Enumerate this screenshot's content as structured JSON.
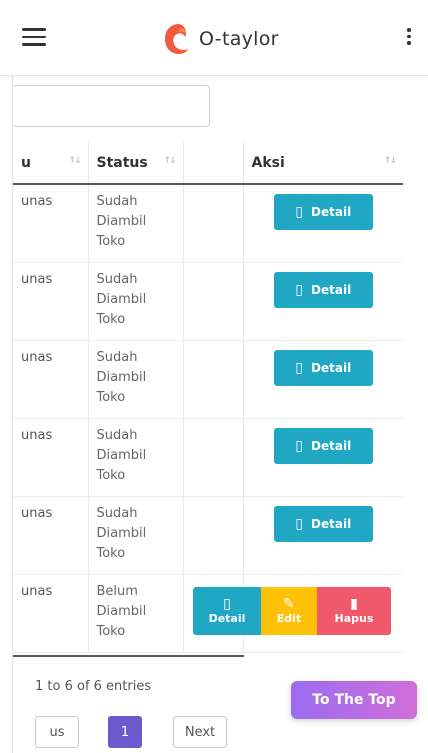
{
  "header": {
    "brand": "O-taylor"
  },
  "table": {
    "columns": [
      "",
      "Status",
      "",
      "Aksi"
    ],
    "sort_icon": "↑↓",
    "rows": [
      {
        "first": "unas",
        "status": "Sudah Diambil Toko",
        "action": "Detail"
      },
      {
        "first": "unas",
        "status": "Sudah Diambil Toko",
        "action": "Detail"
      },
      {
        "first": "unas",
        "status": "Sudah Diambil Toko",
        "action": "Detail"
      },
      {
        "first": "unas",
        "status": "Sudah Diambil Toko",
        "action": "Detail"
      },
      {
        "first": "unas",
        "status": "Sudah Diambil Toko",
        "action": "Detail"
      },
      {
        "first": "unas",
        "status": "Belum Diambil Toko",
        "actions": [
          "Detail",
          "Edit",
          "Hapus"
        ]
      }
    ],
    "first_col_partial": "u",
    "first_col_rows": [
      "unas",
      "unas",
      "unas",
      "unas",
      "unas",
      "unas"
    ]
  },
  "footer": {
    "info": "1 to 6 of 6 entries",
    "pagination": {
      "prev": "us",
      "current": "1",
      "next": "Next"
    }
  },
  "fab": {
    "label": "To The Top"
  },
  "colors": {
    "detail": "#1fa7c4",
    "edit": "#ffc107",
    "hapus": "#f0596b",
    "page_active": "#6a5acd",
    "fab_start": "#9b6cf0",
    "fab_end": "#d06ed8"
  }
}
